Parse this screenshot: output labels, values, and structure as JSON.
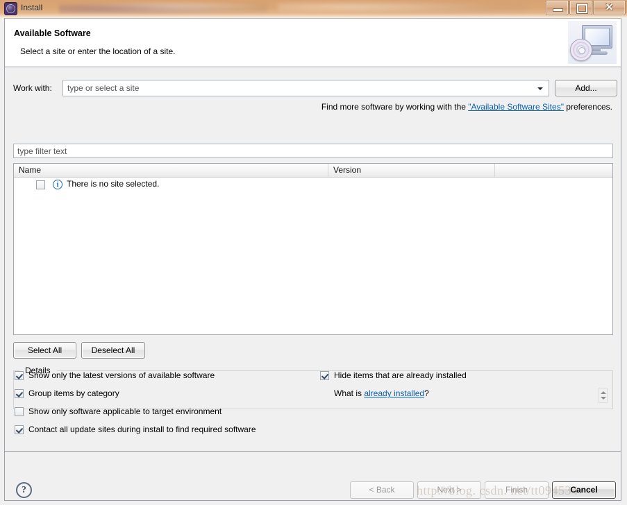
{
  "window": {
    "title": "Install",
    "app_icon": "eclipse-gear-icon",
    "controls": {
      "minimize": "minimize-icon",
      "maximize": "maximize-icon",
      "close": "close-icon",
      "close_glyph": "✕"
    }
  },
  "header": {
    "title": "Available Software",
    "subtitle": "Select a site or enter the location of a site.",
    "banner_icon": "monitor-with-disc-icon"
  },
  "work_with": {
    "label": "Work with:",
    "placeholder": "type or select a site",
    "value": "",
    "add_button": "Add...",
    "hint_prefix": "Find more software by working with the ",
    "hint_link": "\"Available Software Sites\"",
    "hint_suffix": " preferences."
  },
  "filter": {
    "placeholder": "type filter text",
    "value": ""
  },
  "table": {
    "columns": [
      "Name",
      "Version",
      ""
    ],
    "rows": [
      {
        "checked": false,
        "icon": "info-icon",
        "icon_glyph": "i",
        "name": "There is no site selected.",
        "version": ""
      }
    ]
  },
  "actions": {
    "select_all": "Select All",
    "deselect_all": "Deselect All"
  },
  "details": {
    "legend": "Details",
    "text": "",
    "spinner": "scroll-spinner"
  },
  "options": {
    "left": [
      {
        "label": "Show only the latest versions of available software",
        "checked": true
      },
      {
        "label": "Group items by category",
        "checked": true
      },
      {
        "label": "Show only software applicable to target environment",
        "checked": false
      },
      {
        "label": "Contact all update sites during install to find required software",
        "checked": true
      }
    ],
    "right": [
      {
        "label": "Hide items that are already installed",
        "checked": true
      }
    ],
    "whatis_prefix": "What is ",
    "whatis_link": "already installed",
    "whatis_suffix": "?"
  },
  "footer": {
    "help": "?",
    "back": "< Back",
    "next": "Next >",
    "finish": "Finish",
    "cancel": "Cancel"
  },
  "watermark": "http://blog. csdn. net/tt094534",
  "colors": {
    "titlebar": "#d8a272",
    "dialog_bg": "#f0f0f0",
    "link": "#0b5fb0",
    "info": "#1f6cb0",
    "border": "#9aa0a6"
  }
}
